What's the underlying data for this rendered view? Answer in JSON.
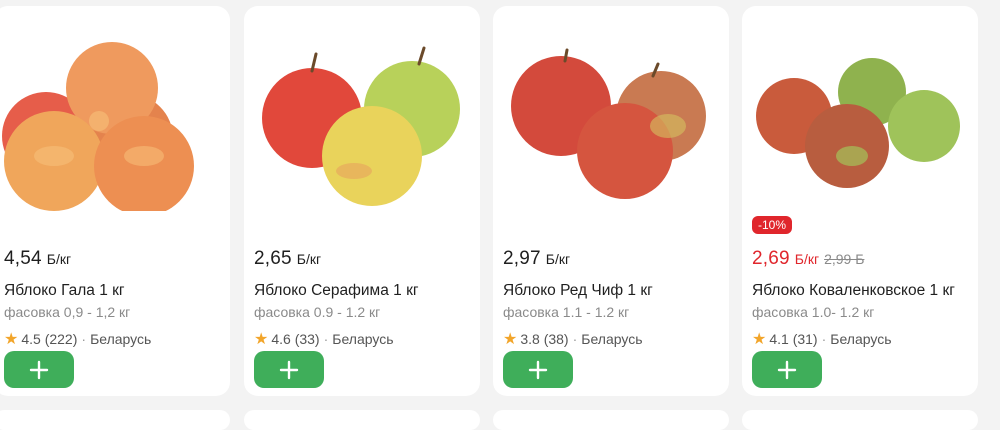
{
  "products": [
    {
      "price": "4,54",
      "unit": "Б/кг",
      "name": "Яблоко Гала 1 кг",
      "pack": "фасовка 0,9 - 1,2 кг",
      "rating": "4.5 (222)",
      "country": "Беларусь"
    },
    {
      "price": "2,65",
      "unit": "Б/кг",
      "name": "Яблоко Серафима 1 кг",
      "pack": "фасовка 0.9 - 1.2 кг",
      "rating": "4.6 (33)",
      "country": "Беларусь"
    },
    {
      "price": "2,97",
      "unit": "Б/кг",
      "name": "Яблоко Ред Чиф 1 кг",
      "pack": "фасовка 1.1 - 1.2 кг",
      "rating": "3.8 (38)",
      "country": "Беларусь"
    },
    {
      "badge": "-10%",
      "price": "2,69",
      "unit": "Б/кг",
      "old_price": "2,99 Б",
      "name": "Яблоко Коваленковское 1 кг",
      "pack": "фасовка 1.0- 1.2 кг",
      "rating": "4.1 (31)",
      "country": "Беларусь"
    }
  ],
  "ui": {
    "separator": "·",
    "accent_color": "#3fae5a",
    "discount_color": "#e0262c",
    "star_color": "#f2a52a",
    "add_icon": "plus-icon",
    "rating_icon": "star-icon"
  }
}
